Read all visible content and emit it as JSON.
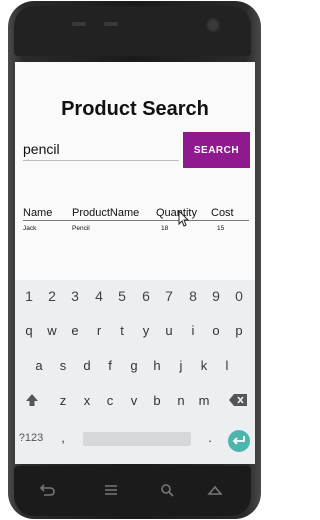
{
  "page": {
    "title": "Product Search"
  },
  "search": {
    "value": "pencil",
    "button_label": "SEARCH"
  },
  "table": {
    "columns": [
      "Name",
      "ProductName",
      "Quantity",
      "Cost"
    ],
    "rows": [
      [
        "Jack",
        "Pencil",
        "18",
        "15"
      ]
    ]
  },
  "keyboard": {
    "row1": [
      "1",
      "2",
      "3",
      "4",
      "5",
      "6",
      "7",
      "8",
      "9",
      "0"
    ],
    "row2": [
      "q",
      "w",
      "e",
      "r",
      "t",
      "y",
      "u",
      "i",
      "o",
      "p"
    ],
    "row3": [
      "a",
      "s",
      "d",
      "f",
      "g",
      "h",
      "j",
      "k",
      "l"
    ],
    "row4": [
      "z",
      "x",
      "c",
      "v",
      "b",
      "n",
      "m"
    ],
    "symbols_label": "?123",
    "comma": ",",
    "period": "."
  },
  "colors": {
    "accent": "#8e1a8e",
    "enter": "#4db6ac"
  }
}
